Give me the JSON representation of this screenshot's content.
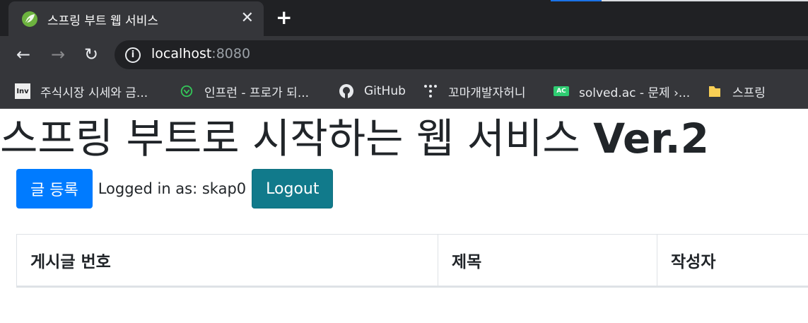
{
  "browser": {
    "tab": {
      "title": "스프링 부트 웹 서비스",
      "favicon": "spring-leaf-icon",
      "close": "✕"
    },
    "new_tab": "+",
    "nav": {
      "back": "←",
      "forward": "→",
      "reload": "↻"
    },
    "url": {
      "host": "localhost",
      "port": ":8080"
    },
    "bookmarks": [
      {
        "label": "주식시장 시세와 금...",
        "icon": "investing-icon",
        "icon_text": "Inv"
      },
      {
        "label": "인프런 - 프로가 되...",
        "icon": "inflearn-icon",
        "icon_text": ""
      },
      {
        "label": "GitHub",
        "icon": "github-icon",
        "icon_text": ""
      },
      {
        "label": "꼬마개발자허니",
        "icon": "dots-icon",
        "icon_text": ""
      },
      {
        "label": "solved.ac - 문제 ›...",
        "icon": "solvedac-icon",
        "icon_text": "AC"
      },
      {
        "label": "스프링",
        "icon": "folder-icon",
        "icon_text": ""
      }
    ]
  },
  "page": {
    "title_main": "스프링 부트로 시작하는 웹 서비스 ",
    "title_version": "Ver.2",
    "post_button": "글 등록",
    "logged_in_text": "Logged in as: skap0",
    "logout_button": "Logout",
    "table_headers": [
      "게시글 번호",
      "제목",
      "작성자"
    ]
  },
  "colors": {
    "primary": "#007bff",
    "info": "#117a8b",
    "chrome_dark": "#202124",
    "chrome_mid": "#35363a"
  }
}
